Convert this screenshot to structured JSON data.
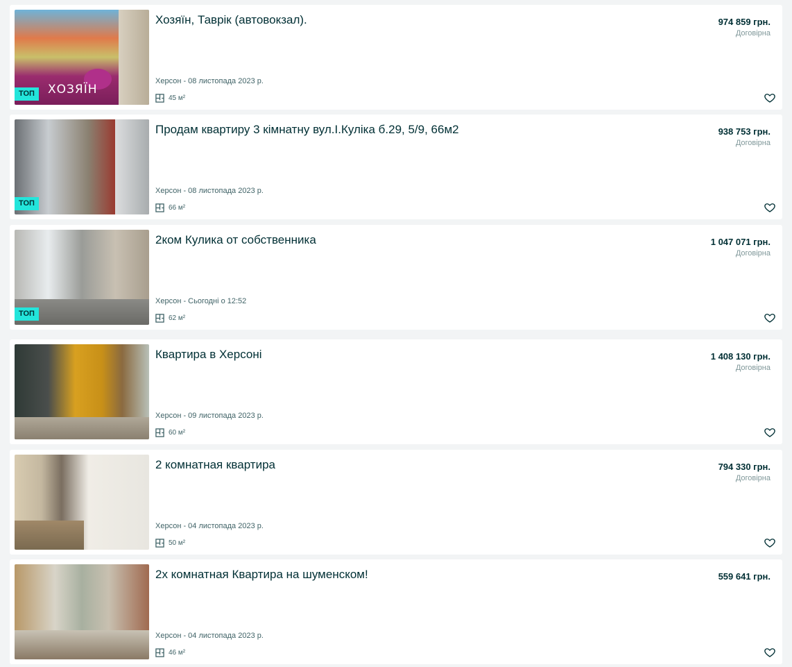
{
  "listings": [
    {
      "title": "Хозяїн, Таврік (автовокзал).",
      "location": "Херсон - 08 листопада 2023 р.",
      "area": "45 м²",
      "price": "974 859 грн.",
      "negotiable": "Договірна",
      "badge": "ТОП",
      "photo_caption": "ХОЗЯЇН"
    },
    {
      "title": "Продам квартиру 3 кімнатну вул.І.Куліка б.29, 5/9, 66м2",
      "location": "Херсон - 08 листопада 2023 р.",
      "area": "66 м²",
      "price": "938 753 грн.",
      "negotiable": "Договірна",
      "badge": "ТОП"
    },
    {
      "title": "2ком Кулика от собственника",
      "location": "Херсон - Сьогодні о 12:52",
      "area": "62 м²",
      "price": "1 047 071 грн.",
      "negotiable": "Договірна",
      "badge": "ТОП"
    },
    {
      "title": "Квартира в Херсоні",
      "location": "Херсон - 09 листопада 2023 р.",
      "area": "60 м²",
      "price": "1 408 130 грн.",
      "negotiable": "Договірна"
    },
    {
      "title": "2 комнатная квартира",
      "location": "Херсон - 04 листопада 2023 р.",
      "area": "50 м²",
      "price": "794 330 грн.",
      "negotiable": "Договірна"
    },
    {
      "title": "2х комнатная Квартира на шуменском!",
      "location": "Херсон - 04 листопада 2023 р.",
      "area": "46 м²",
      "price": "559 641 грн."
    }
  ],
  "icons": {
    "area": "floor-plan-icon",
    "favorite": "heart-outline-icon"
  },
  "colors": {
    "badge": "#23e5db",
    "text": "#002f34",
    "muted": "#7f9799",
    "background": "#f2f4f5"
  }
}
